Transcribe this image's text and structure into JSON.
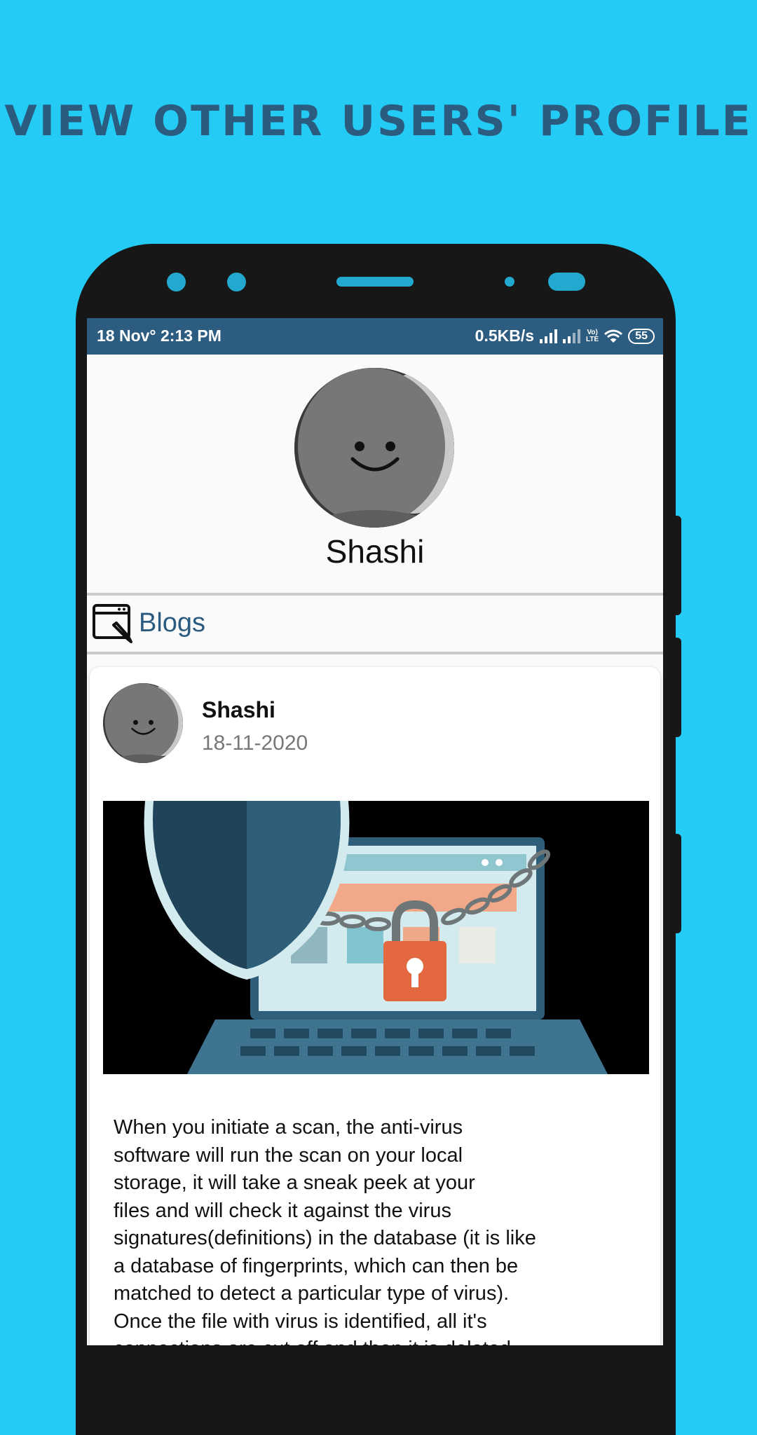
{
  "headline": "VIEW OTHER USERS' PROFILE",
  "status_bar": {
    "date_time": "18 Nov°  2:13 PM",
    "network_speed": "0.5KB/s",
    "volte_top": "Vo)",
    "volte_bottom": "LTE",
    "battery": "55",
    "icons": [
      "signal-icon",
      "signal-icon",
      "volte-icon",
      "wifi-icon",
      "battery-icon"
    ]
  },
  "profile": {
    "name": "Shashi",
    "avatar_icon": "smiley-avatar"
  },
  "section": {
    "label": "Blogs",
    "icon": "blog-edit-icon"
  },
  "post": {
    "author": "Shashi",
    "date": "18-11-2020",
    "image_icon": "security-laptop-illustration",
    "text": "When you initiate a scan, the anti-virus\nsoftware will run the scan on your local\nstorage, it will take a sneak peek at your\nfiles and will check it against the virus\nsignatures(definitions) in the database (it is like\na database of fingerprints, which can then be\nmatched to detect a particular type of virus).\nOnce the file with virus is identified, all it's\nconnections are cut off and then it is deleted."
  },
  "colors": {
    "background": "#23CBF5",
    "headline": "#2B5B7F",
    "status_bar": "#2C5C80",
    "accent": "#2B5B7F"
  }
}
